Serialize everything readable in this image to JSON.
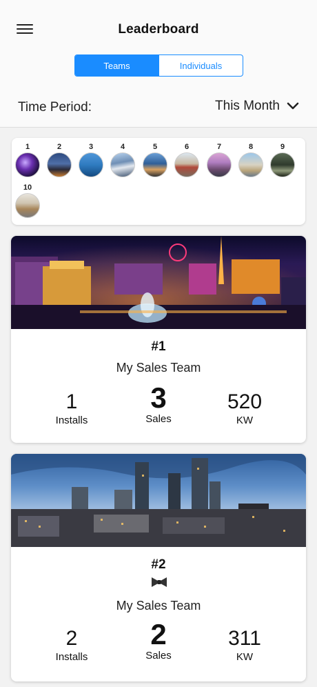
{
  "header": {
    "title": "Leaderboard",
    "tabs": [
      {
        "label": "Teams",
        "active": true
      },
      {
        "label": "Individuals",
        "active": false
      }
    ],
    "time_period_label": "Time Period:",
    "time_period_value": "This Month"
  },
  "rank_strip": [
    {
      "rank": "1"
    },
    {
      "rank": "2"
    },
    {
      "rank": "3"
    },
    {
      "rank": "4"
    },
    {
      "rank": "5"
    },
    {
      "rank": "6"
    },
    {
      "rank": "7"
    },
    {
      "rank": "8"
    },
    {
      "rank": "9"
    },
    {
      "rank": "10"
    }
  ],
  "cards": [
    {
      "rank": "#1",
      "team": "My Sales Team",
      "stats": [
        {
          "value": "1",
          "label": "Installs"
        },
        {
          "value": "3",
          "label": "Sales"
        },
        {
          "value": "520",
          "label": "KW"
        }
      ]
    },
    {
      "rank": "#2",
      "badge_icon": "bowtie-icon",
      "team": "My Sales Team",
      "stats": [
        {
          "value": "2",
          "label": "Installs"
        },
        {
          "value": "2",
          "label": "Sales"
        },
        {
          "value": "311",
          "label": "KW"
        }
      ]
    }
  ],
  "colors": {
    "accent": "#1a8cff"
  }
}
